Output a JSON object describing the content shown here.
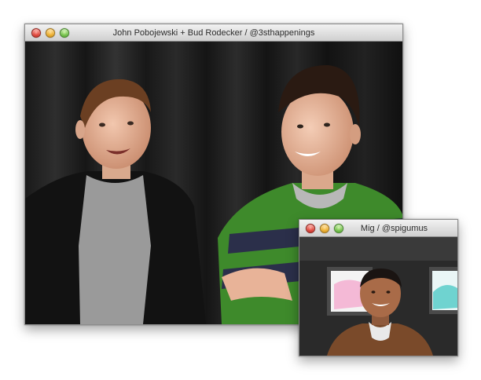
{
  "main_window": {
    "title": "John Pobojewski + Bud Rodecker / @3sthappenings"
  },
  "secondary_window": {
    "title": "Mig / @spigumus"
  },
  "icons": {
    "close": "close-button-red",
    "minimize": "minimize-button-yellow",
    "zoom": "zoom-button-green"
  },
  "colors": {
    "close": "#e0453a",
    "minimize": "#eeaf2c",
    "zoom": "#74c24a",
    "titlebar": "#dcdcdc"
  }
}
